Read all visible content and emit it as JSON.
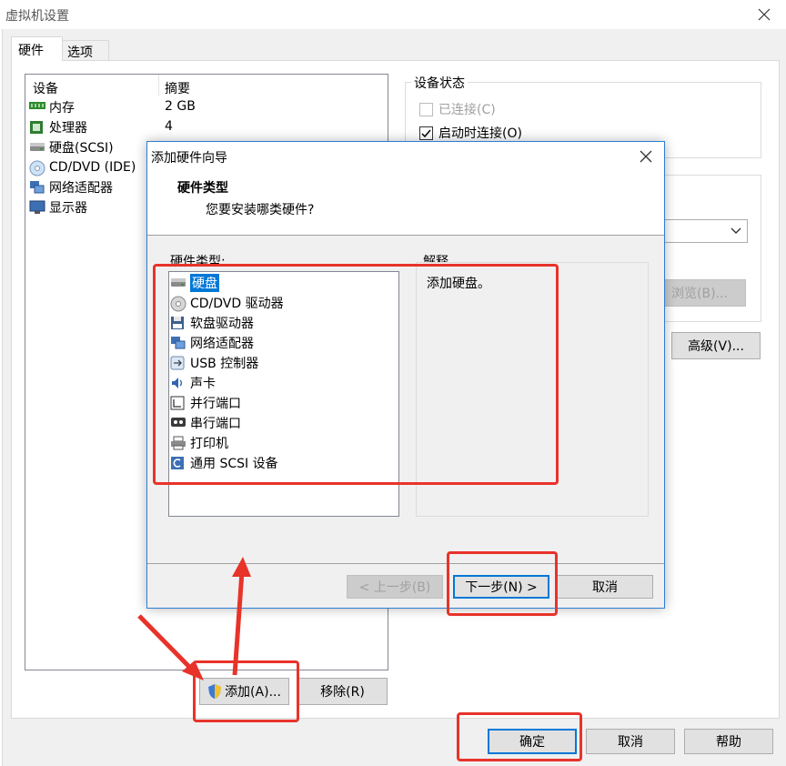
{
  "window": {
    "title": "虚拟机设置"
  },
  "tabs": [
    {
      "label": "硬件"
    },
    {
      "label": "选项"
    }
  ],
  "device_table": {
    "col_device": "设备",
    "col_summary": "摘要",
    "rows": [
      {
        "icon": "memory-icon",
        "name": "内存",
        "summary": "2 GB"
      },
      {
        "icon": "processor-icon",
        "name": "处理器",
        "summary": "4"
      },
      {
        "icon": "hard-disk-icon",
        "name": "硬盘(SCSI)",
        "summary": ""
      },
      {
        "icon": "cd-dvd-icon",
        "name": "CD/DVD (IDE)",
        "summary": ""
      },
      {
        "icon": "network-adapter-icon",
        "name": "网络适配器",
        "summary": ""
      },
      {
        "icon": "display-icon",
        "name": "显示器",
        "summary": ""
      }
    ]
  },
  "device_status": {
    "title": "设备状态",
    "connected": {
      "label": "已连接(C)",
      "checked": false,
      "enabled": false
    },
    "connect_on_start": {
      "label": "启动时连接(O)",
      "checked": true
    }
  },
  "browse_button": "浏览(B)...",
  "advanced_button": "高级(V)...",
  "add_button": "添加(A)...",
  "remove_button": "移除(R)",
  "footer": {
    "ok": "确定",
    "cancel": "取消",
    "help": "帮助"
  },
  "wizard": {
    "title": "添加硬件向导",
    "heading": "硬件类型",
    "subheading": "您要安装哪类硬件?",
    "list_label": "硬件类型:",
    "explain_label": "解释",
    "explanation": "添加硬盘。",
    "hardware_types": [
      {
        "icon": "hard-disk-icon",
        "label": "硬盘",
        "selected": true
      },
      {
        "icon": "cd-dvd-drive-icon",
        "label": "CD/DVD 驱动器"
      },
      {
        "icon": "floppy-drive-icon",
        "label": "软盘驱动器"
      },
      {
        "icon": "network-adapter-icon",
        "label": "网络适配器"
      },
      {
        "icon": "usb-controller-icon",
        "label": "USB 控制器"
      },
      {
        "icon": "sound-card-icon",
        "label": "声卡"
      },
      {
        "icon": "parallel-port-icon",
        "label": "并行端口"
      },
      {
        "icon": "serial-port-icon",
        "label": "串行端口"
      },
      {
        "icon": "printer-icon",
        "label": "打印机"
      },
      {
        "icon": "generic-scsi-icon",
        "label": "通用 SCSI 设备"
      }
    ],
    "back_button": "< 上一步(B)",
    "next_button": "下一步(N) >",
    "cancel_button": "取消"
  },
  "annotation_color": "#e8332a"
}
